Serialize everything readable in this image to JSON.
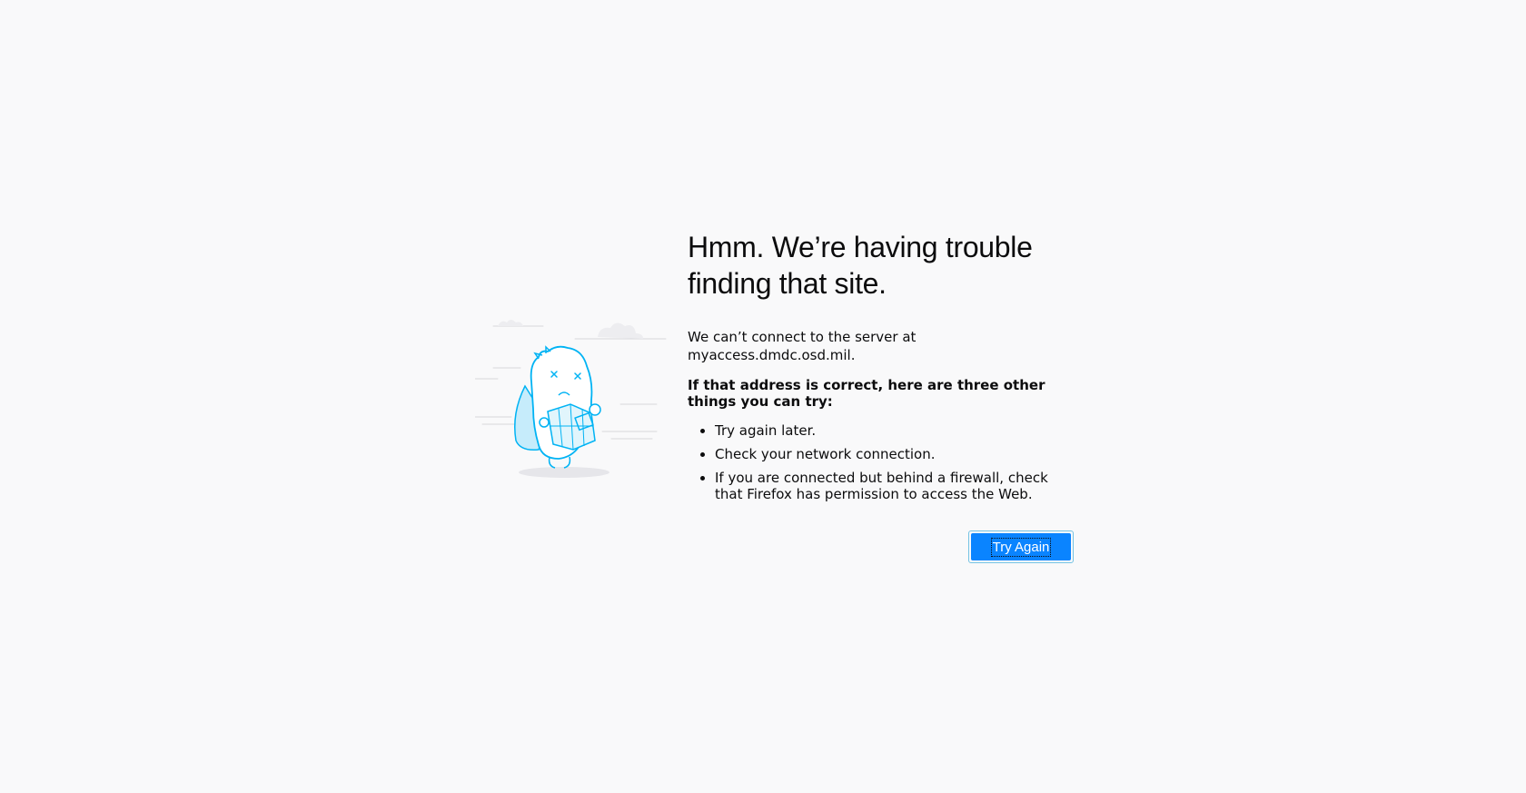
{
  "page": {
    "title_line1": "Hmm. We’re having trouble",
    "title_line2": "finding that site.",
    "description": "We can’t connect to the server at myaccess.dmdc.osd.mil.",
    "try_heading": "If that address is correct, here are three other things you can try:",
    "suggestions": [
      "Try again later.",
      "Check your network connection.",
      "If you are connected but behind a firewall, check that Firefox has permission to access the Web."
    ],
    "try_again_label": "Try Again"
  },
  "illustration": {
    "icon": "confused-monster-with-map-icon",
    "accent_color": "#00b3f4",
    "fill_color": "#e1f5fc",
    "cloud_color": "#ededf0"
  },
  "colors": {
    "background": "#f9f9fa",
    "button": "#0a84ff",
    "button_text": "#ffffff"
  }
}
